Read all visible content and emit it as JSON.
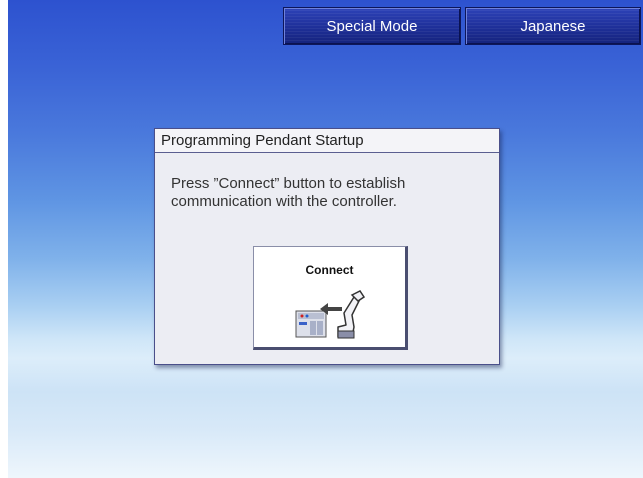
{
  "header": {
    "special_mode_label": "Special Mode",
    "japanese_label": "Japanese"
  },
  "dialog": {
    "title": "Programming Pendant Startup",
    "message_line1": "Press ”Connect” button to establish",
    "message_line2": "communication with the controller.",
    "connect_label": "Connect"
  },
  "icons": {
    "connect": "controller-robot-icon"
  },
  "colors": {
    "top_button": "#1e2f98",
    "dialog_bg": "#ecedf3",
    "desktop_top": "#2d52cf",
    "desktop_bottom": "#eef6fc"
  }
}
